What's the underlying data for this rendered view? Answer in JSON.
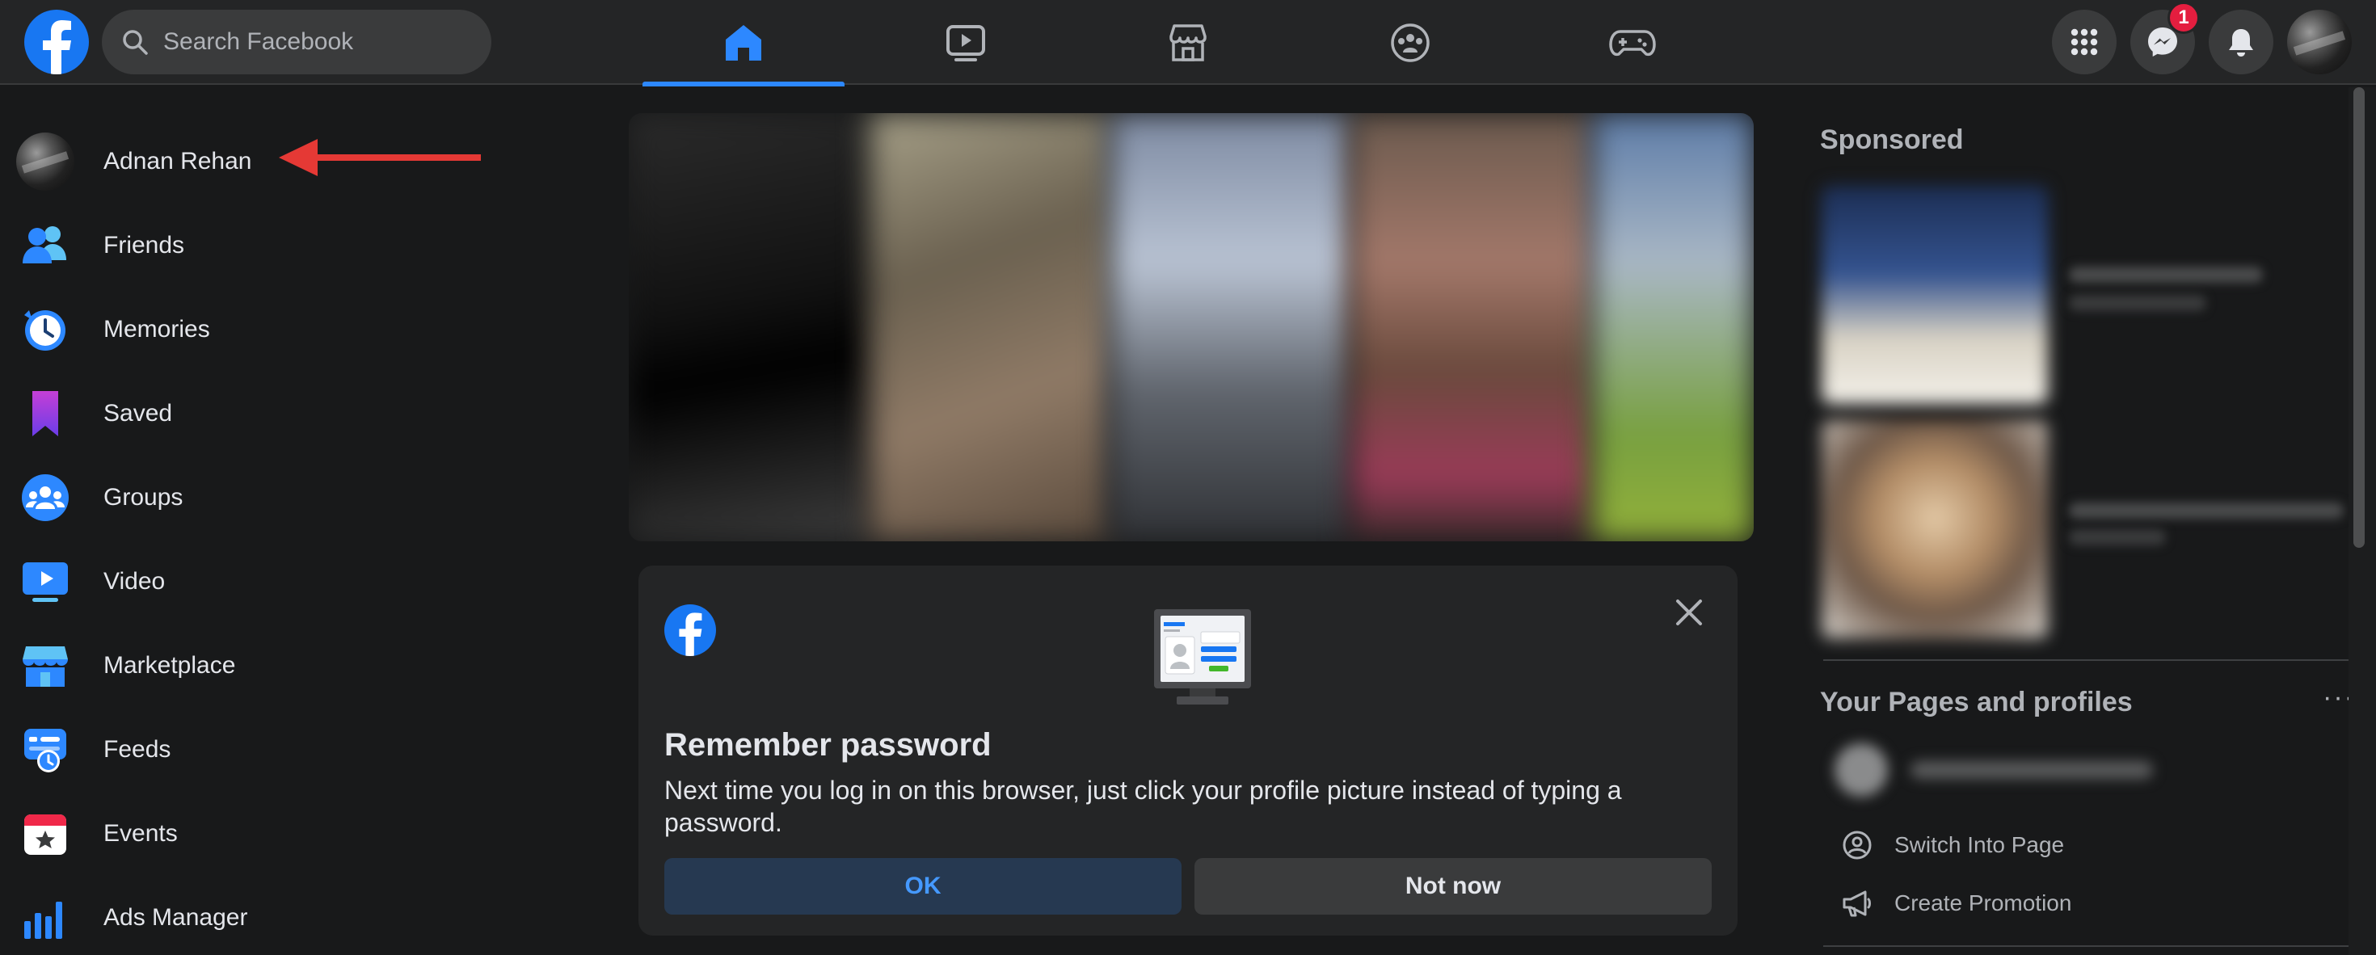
{
  "header": {
    "search_placeholder": "Search Facebook",
    "nav_tabs": [
      "home-icon",
      "watch-icon",
      "marketplace-icon",
      "groups-icon",
      "gaming-icon"
    ],
    "active_tab": "home-icon",
    "messenger_badge": "1"
  },
  "sidebar": {
    "items": [
      {
        "label": "Adnan Rehan",
        "icon": "avatar"
      },
      {
        "label": "Friends",
        "icon": "friends-icon"
      },
      {
        "label": "Memories",
        "icon": "memories-icon"
      },
      {
        "label": "Saved",
        "icon": "saved-icon"
      },
      {
        "label": "Groups",
        "icon": "groups-icon"
      },
      {
        "label": "Video",
        "icon": "video-icon"
      },
      {
        "label": "Marketplace",
        "icon": "marketplace-icon"
      },
      {
        "label": "Feeds",
        "icon": "feeds-icon"
      },
      {
        "label": "Events",
        "icon": "events-icon"
      },
      {
        "label": "Ads Manager",
        "icon": "ads-manager-icon"
      }
    ]
  },
  "remember_password": {
    "title": "Remember password",
    "text": "Next time you log in on this browser, just click your profile picture instead of typing a password.",
    "ok_label": "OK",
    "not_now_label": "Not now"
  },
  "right_column": {
    "sponsored_title": "Sponsored",
    "pages_title": "Your Pages and profiles",
    "more_label": "···",
    "actions": [
      {
        "label": "Switch Into Page",
        "icon": "switch-profile-icon"
      },
      {
        "label": "Create Promotion",
        "icon": "megaphone-icon"
      }
    ]
  },
  "colors": {
    "background": "#18191a",
    "surface": "#242526",
    "accent": "#2d88ff",
    "brand": "#1877f2",
    "badge": "#e41e3f",
    "annotation_arrow": "#e53935"
  }
}
